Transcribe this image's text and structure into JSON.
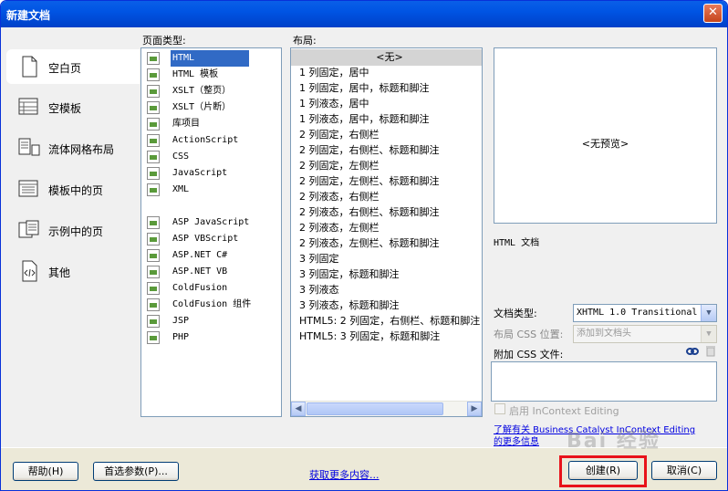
{
  "window": {
    "title": "新建文档",
    "close": "✕"
  },
  "nav": {
    "items": [
      {
        "label": "空白页",
        "icon": "blank-page-icon",
        "selected": true
      },
      {
        "label": "空模板",
        "icon": "blank-template-icon"
      },
      {
        "label": "流体网格布局",
        "icon": "fluid-grid-icon"
      },
      {
        "label": "模板中的页",
        "icon": "page-from-template-icon"
      },
      {
        "label": "示例中的页",
        "icon": "page-from-sample-icon"
      },
      {
        "label": "其他",
        "icon": "other-code-icon"
      }
    ]
  },
  "page_type": {
    "label": "页面类型:",
    "items": [
      "HTML",
      "HTML 模板",
      "XSLT（整页）",
      "XSLT（片断）",
      "库项目",
      "ActionScript",
      "CSS",
      "JavaScript",
      "XML",
      "",
      "ASP JavaScript",
      "ASP VBScript",
      "ASP.NET C#",
      "ASP.NET VB",
      "ColdFusion",
      "ColdFusion 组件",
      "JSP",
      "PHP"
    ],
    "selected": "HTML"
  },
  "layout": {
    "label": "布局:",
    "items": [
      "<无>",
      "1 列固定，居中",
      "1 列固定，居中，标题和脚注",
      "1 列液态，居中",
      "1 列液态，居中，标题和脚注",
      "2 列固定，右侧栏",
      "2 列固定，右侧栏、标题和脚注",
      "2 列固定，左侧栏",
      "2 列固定，左侧栏、标题和脚注",
      "2 列液态，右侧栏",
      "2 列液态，右侧栏、标题和脚注",
      "2 列液态，左侧栏",
      "2 列液态，左侧栏、标题和脚注",
      "3 列固定",
      "3 列固定，标题和脚注",
      "3 列液态",
      "3 列液态，标题和脚注",
      "HTML5: 2 列固定，右侧栏、标题和脚注",
      "HTML5: 3 列固定，标题和脚注"
    ],
    "selected": "<无>"
  },
  "preview": {
    "text": "<无预览>",
    "description": "HTML 文档"
  },
  "doctype": {
    "label": "文档类型:",
    "value": "XHTML 1.0 Transitional"
  },
  "layout_css": {
    "label": "布局 CSS 位置:",
    "value": "添加到文档头"
  },
  "attach_css": {
    "label": "附加 CSS 文件:"
  },
  "incontext": {
    "label": "启用 InContext Editing"
  },
  "learn_more": {
    "text": "了解有关 Business Catalyst InContext Editing 的更多信息"
  },
  "buttons": {
    "help": "帮助(H)",
    "prefs": "首选参数(P)...",
    "more": "获取更多内容...",
    "create": "创建(R)",
    "cancel": "取消(C)"
  },
  "watermark": "Bai 经验"
}
